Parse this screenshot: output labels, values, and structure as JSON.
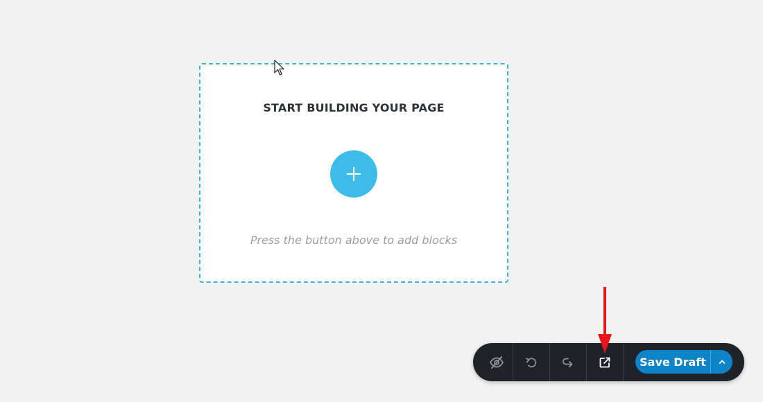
{
  "drop_zone": {
    "title": "START BUILDING YOUR PAGE",
    "hint": "Press the button above to add blocks",
    "add_icon": "plus-icon",
    "accent_color": "#3cbce6"
  },
  "toolbar": {
    "icons": [
      "eye-off-icon",
      "undo-icon",
      "redo-icon",
      "external-link-icon"
    ],
    "save_label": "Save Draft",
    "save_options_icon": "chevron-up-icon",
    "primary_color": "#0e84c8",
    "background_color": "#1f2329"
  },
  "annotation": {
    "arrow_color": "#e8141b"
  }
}
